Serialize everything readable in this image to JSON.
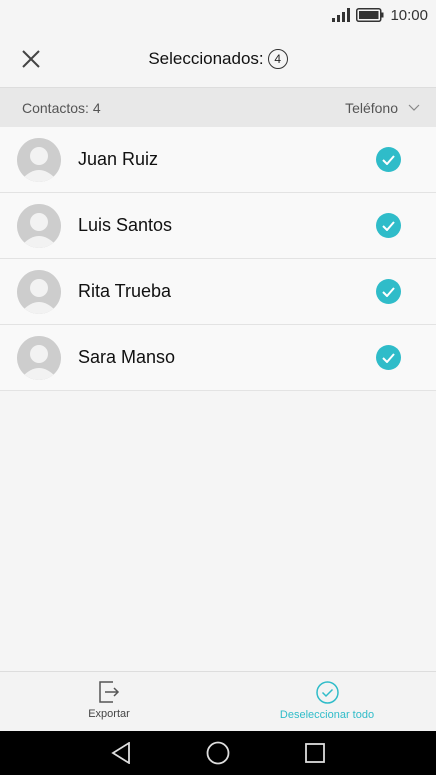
{
  "status_bar": {
    "time": "10:00",
    "icons": [
      "signal-icon",
      "battery-icon"
    ]
  },
  "header": {
    "title": "Seleccionados:",
    "count": "4",
    "close_icon": "close-icon"
  },
  "subbar": {
    "count_label": "Contactos: 4",
    "sort_label": "Teléfono"
  },
  "contacts": [
    {
      "name": "Juan Ruiz",
      "selected": true
    },
    {
      "name": "Luis Santos",
      "selected": true
    },
    {
      "name": "Rita Trueba",
      "selected": true
    },
    {
      "name": "Sara Manso",
      "selected": true
    }
  ],
  "bottom_actions": {
    "export_label": "Exportar",
    "deselect_label": "Deseleccionar todo"
  },
  "nav": {
    "back": "back-icon",
    "home": "home-icon",
    "recents": "recents-icon"
  },
  "colors": {
    "accent": "#2fbcc9",
    "background": "#f5f5f5",
    "subbar": "#e8e8e8"
  }
}
